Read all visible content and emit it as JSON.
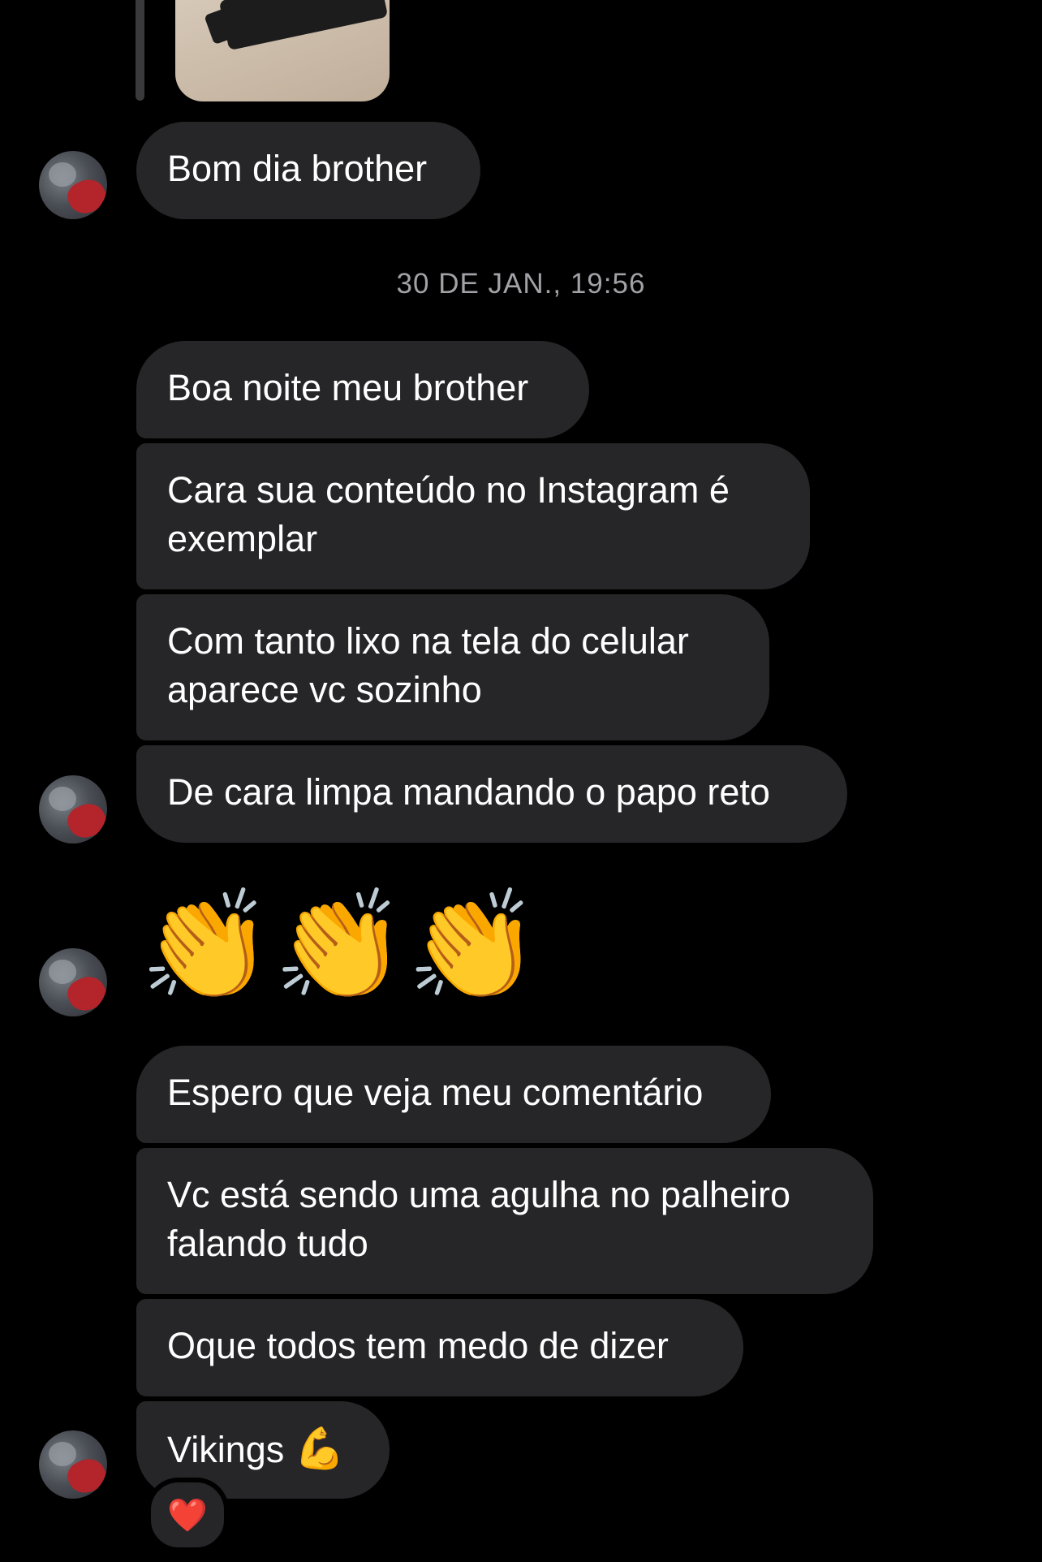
{
  "thread": {
    "shared_media_alt": "shared image thumbnail"
  },
  "messages": [
    {
      "text": "Bom dia brother"
    },
    {
      "lines": [
        "Boa noite meu brother"
      ]
    },
    {
      "lines": [
        "Cara sua conteúdo no Instagram é",
        "exemplar"
      ]
    },
    {
      "lines": [
        "Com tanto lixo na tela do celular",
        "aparece vc sozinho"
      ]
    },
    {
      "lines": [
        "De cara limpa mandando o papo reto"
      ]
    },
    {
      "emoji": "👏👏👏"
    },
    {
      "lines": [
        "Espero que veja meu comentário"
      ]
    },
    {
      "lines": [
        "Vc está sendo uma agulha no palheiro",
        "falando tudo"
      ]
    },
    {
      "lines": [
        "Oque todos tem medo de dizer"
      ]
    },
    {
      "text": "Vikings",
      "emoji": "💪"
    }
  ],
  "timestamp": "30 DE JAN., 19:56",
  "reaction": {
    "emoji": "❤️"
  },
  "colors": {
    "background": "#000000",
    "bubble": "#262628",
    "timestamp_text": "#a1a1a6",
    "reaction_heart": "#ff2d3f"
  }
}
